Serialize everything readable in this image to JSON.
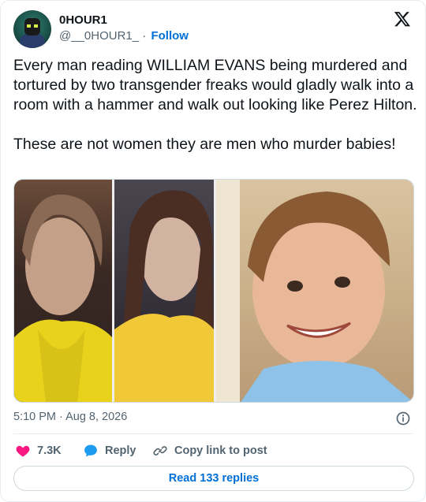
{
  "author": {
    "name": "0HOUR1",
    "handle": "@__0HOUR1_",
    "separator": "·",
    "follow_label": "Follow"
  },
  "tweet": {
    "text": "Every man reading WILLIAM EVANS being murdered and tortured by two transgender freaks would gladly walk into a room with a hammer and walk out looking like Perez Hilton.\n\nThese are not women they are men who murder babies!"
  },
  "timestamp": "5:10 PM · Aug 8, 2026",
  "actions": {
    "like_count": "7.3K",
    "reply_label": "Reply",
    "copy_label": "Copy link to post"
  },
  "read_replies_label": "Read 133 replies",
  "icons": {
    "platform": "x-logo-icon",
    "like": "heart-icon",
    "reply": "speech-bubble-icon",
    "copy": "link-icon",
    "info": "info-icon"
  },
  "colors": {
    "link_blue": "#006fd6",
    "like_pink": "#f91880",
    "reply_blue": "#1d9bf0",
    "muted_text": "#536471"
  }
}
